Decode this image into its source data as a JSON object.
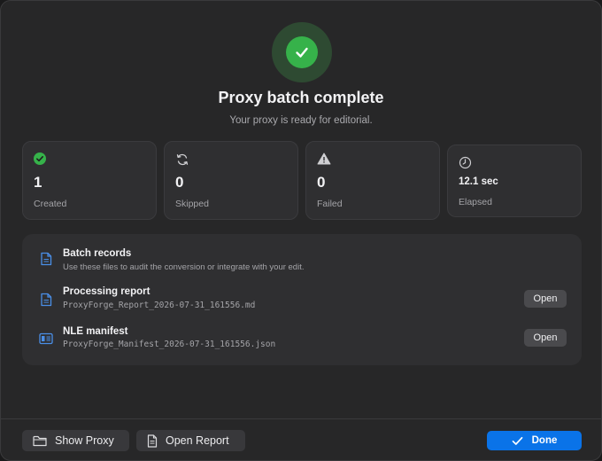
{
  "header": {
    "title": "Proxy batch complete",
    "subtitle": "Your proxy is ready for editorial."
  },
  "stats": [
    {
      "value": "1",
      "label": "Created",
      "icon": "check-circle-icon",
      "color": "#36b24a"
    },
    {
      "value": "0",
      "label": "Skipped",
      "icon": "refresh-icon"
    },
    {
      "value": "0",
      "label": "Failed",
      "icon": "warning-triangle-icon"
    },
    {
      "value": "12.1 sec",
      "label": "Elapsed",
      "icon": "clock-icon"
    }
  ],
  "records": {
    "title": "Batch records",
    "description": "Use these files to audit the conversion or integrate with your edit.",
    "items": [
      {
        "title": "Processing report",
        "filename": "ProxyForge_Report_2026-07-31_161556.md",
        "icon": "document-icon",
        "action": "Open"
      },
      {
        "title": "NLE manifest",
        "filename": "ProxyForge_Manifest_2026-07-31_161556.json",
        "icon": "manifest-icon",
        "action": "Open"
      }
    ]
  },
  "footer": {
    "show_proxy": "Show Proxy",
    "open_report": "Open Report",
    "done": "Done"
  },
  "colors": {
    "accent": "#0a73e8",
    "success": "#36b24a",
    "icon_blue": "#4a8fe8"
  }
}
